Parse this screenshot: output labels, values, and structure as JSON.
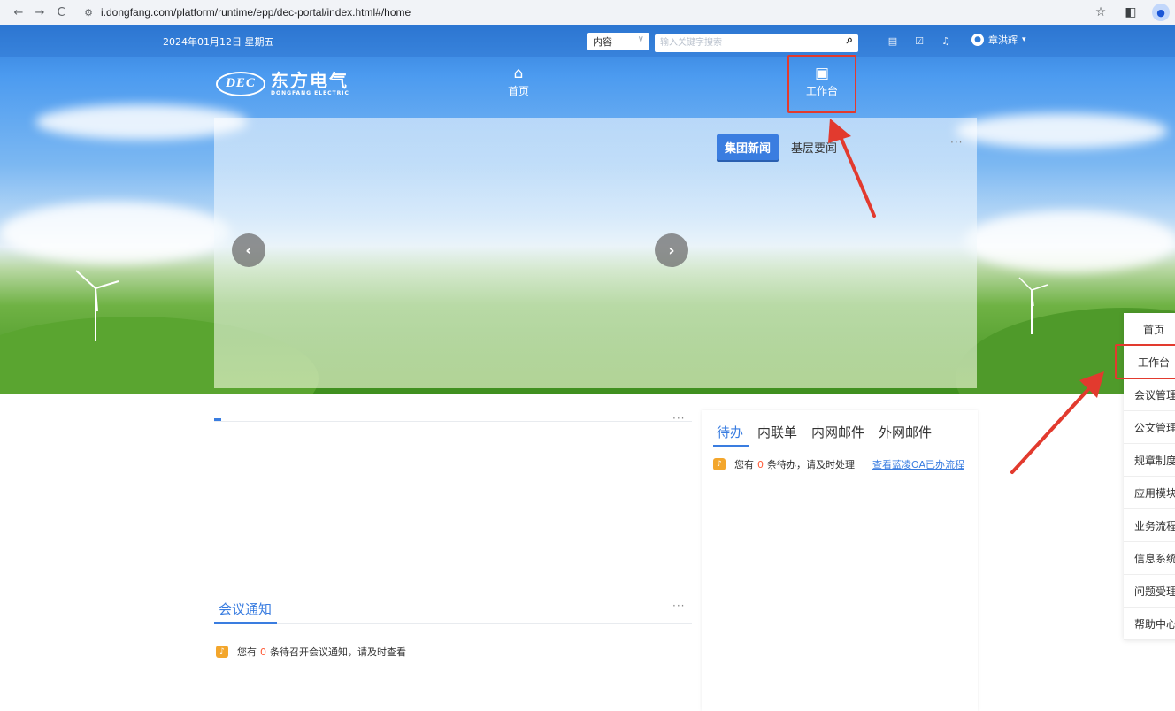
{
  "browser": {
    "url": "i.dongfang.com/platform/runtime/epp/dec-portal/index.html#/home"
  },
  "header": {
    "date": "2024年01月12日 星期五",
    "search_scope": "内容",
    "search_placeholder": "输入关键字搜索",
    "user_name": "章洪辉"
  },
  "logo": {
    "mark": "DEC",
    "cn": "东方电气",
    "en": "DONGFANG ELECTRIC"
  },
  "main_nav": {
    "home_label": "首页",
    "workbench_label": "工作台"
  },
  "banner": {
    "tab_active": "集团新闻",
    "tab_other": "基层要闻",
    "more": "···"
  },
  "left_panel": {
    "more": "···"
  },
  "meeting": {
    "title": "会议通知",
    "more": "···",
    "notice_prefix": "您有",
    "count": "0",
    "notice_suffix": "条待召开会议通知，请及时查看"
  },
  "tasks": {
    "tabs": [
      "待办",
      "内联单",
      "内网邮件",
      "外网邮件"
    ],
    "notice_prefix": "您有",
    "count": "0",
    "notice_suffix": "条待办，请及时处理",
    "link": "查看蓝凌OA已办流程"
  },
  "side_nav": {
    "items": [
      "首页",
      "工作台",
      "会议管理",
      "公文管理",
      "规章制度",
      "应用模块",
      "业务流程",
      "信息系统",
      "问题受理",
      "帮助中心"
    ]
  },
  "colors": {
    "accent": "#3a7de0",
    "annotation": "#e23a2e",
    "bell": "#f3a62c",
    "zero": "#ff5a36"
  },
  "icons": {
    "home": "home-icon",
    "workbench": "monitor-icon",
    "search": "search-icon",
    "bell": "bell-icon"
  }
}
